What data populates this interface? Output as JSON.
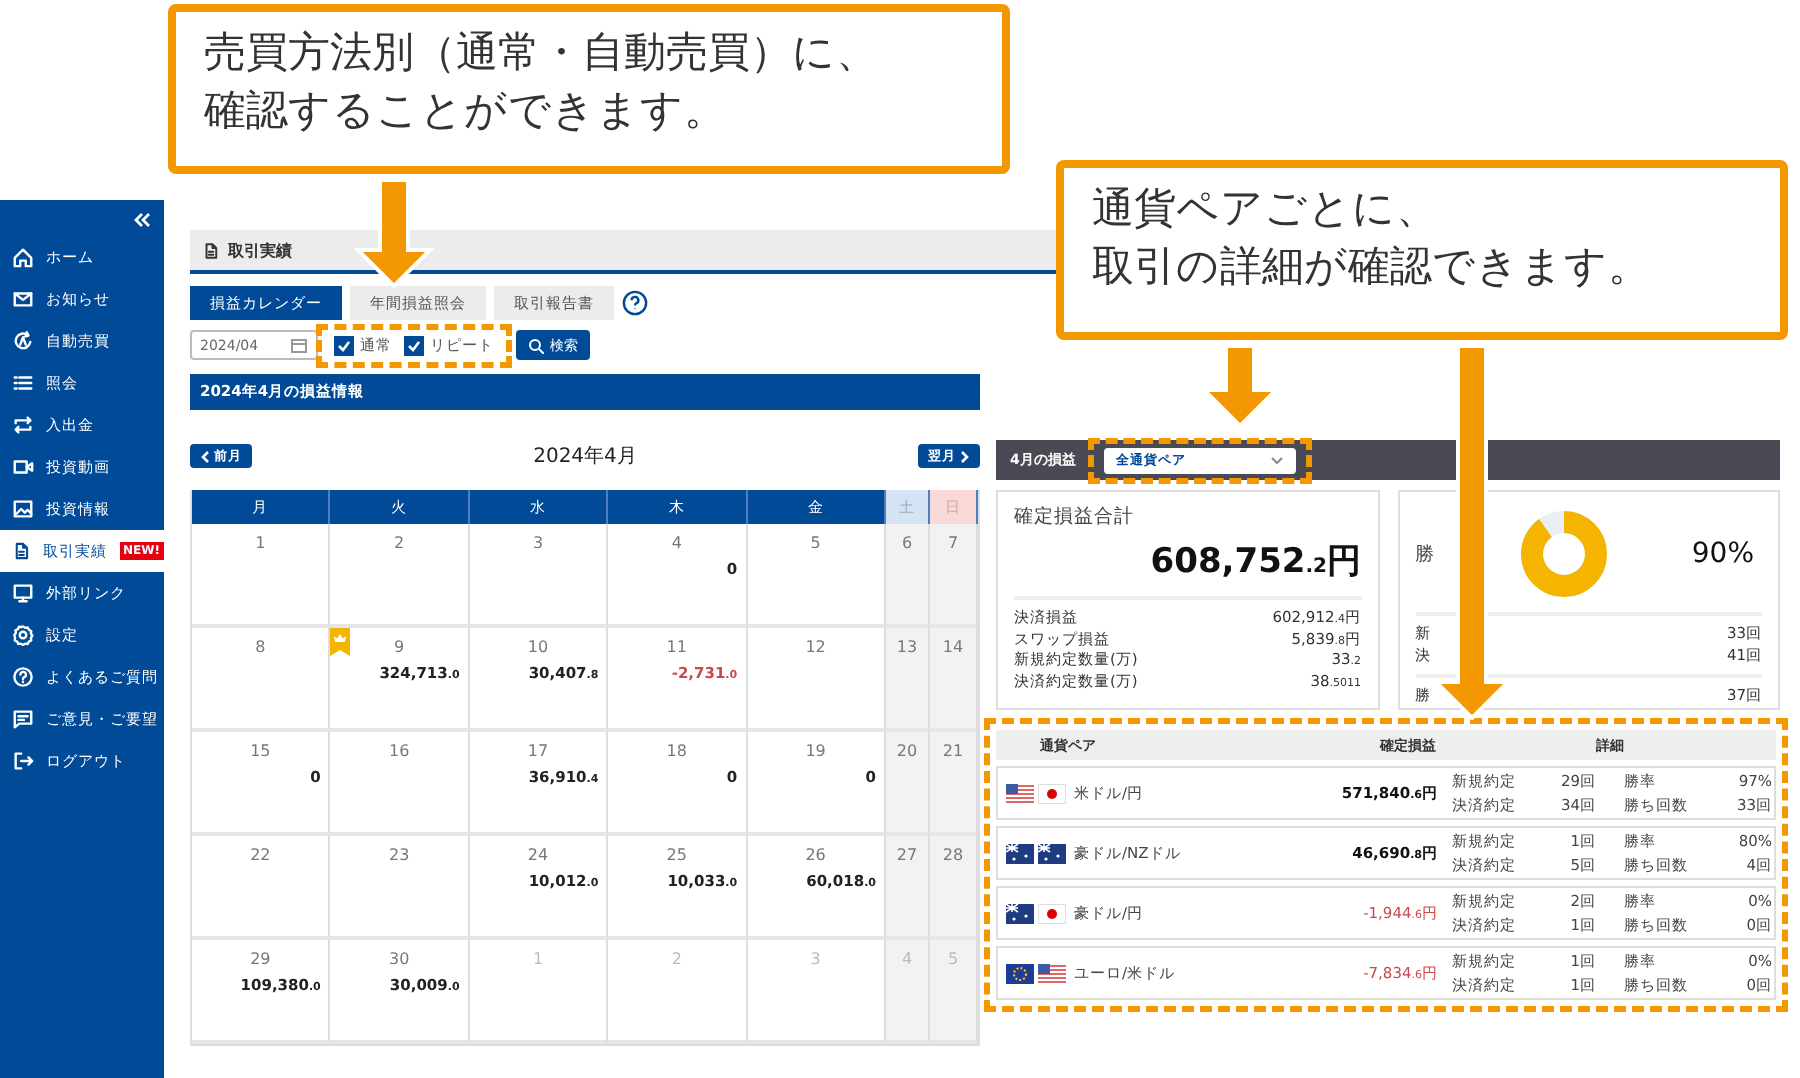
{
  "callouts": [
    {
      "lines": [
        "売買方法別（通常・自動売買）に、",
        "確認することができます。"
      ]
    },
    {
      "lines": [
        "通貨ペアごとに、",
        "取引の詳細が確認できます。"
      ]
    }
  ],
  "sidebar": {
    "items": [
      {
        "label": "ホーム",
        "selected": false
      },
      {
        "label": "お知らせ",
        "selected": false
      },
      {
        "label": "自動売買",
        "selected": false
      },
      {
        "label": "照会",
        "selected": false
      },
      {
        "label": "入出金",
        "selected": false
      },
      {
        "label": "投資動画",
        "selected": false
      },
      {
        "label": "投資情報",
        "selected": false
      },
      {
        "label": "取引実績",
        "selected": true,
        "badge": "NEW!"
      },
      {
        "label": "外部リンク",
        "selected": false
      },
      {
        "label": "設定",
        "selected": false
      },
      {
        "label": "よくあるご質問",
        "selected": false
      },
      {
        "label": "ご意見・ご要望",
        "selected": false
      },
      {
        "label": "ログアウト",
        "selected": false
      }
    ]
  },
  "page_title": "取引実績",
  "tabs": [
    {
      "label": "損益カレンダー",
      "selected": true
    },
    {
      "label": "年間損益照会",
      "selected": false
    },
    {
      "label": "取引報告書",
      "selected": false
    }
  ],
  "filter": {
    "month": "2024/04",
    "checkboxes": [
      {
        "label": "通常",
        "checked": true
      },
      {
        "label": "リピート",
        "checked": true
      }
    ],
    "search_button": "検索"
  },
  "section_header": "2024年4月の損益情報",
  "calendar": {
    "prev": "前月",
    "title": "2024年4月",
    "next": "翌月",
    "weekdays": [
      {
        "label": "月",
        "kind": "weekday"
      },
      {
        "label": "火",
        "kind": "weekday"
      },
      {
        "label": "水",
        "kind": "weekday"
      },
      {
        "label": "木",
        "kind": "weekday"
      },
      {
        "label": "金",
        "kind": "weekday"
      },
      {
        "label": "土",
        "kind": "saturday"
      },
      {
        "label": "日",
        "kind": "sunday"
      }
    ],
    "weeks": [
      [
        {
          "day": "1",
          "muted": false
        },
        {
          "day": "2",
          "muted": false
        },
        {
          "day": "3",
          "muted": false
        },
        {
          "day": "4",
          "muted": false,
          "value": "0",
          "negative": false
        },
        {
          "day": "5",
          "muted": false
        },
        {
          "day": "6",
          "muted": false
        },
        {
          "day": "7",
          "muted": false
        }
      ],
      [
        {
          "day": "8",
          "muted": false
        },
        {
          "day": "9",
          "muted": false,
          "value": "324,713.0",
          "negative": false,
          "ribbon": true
        },
        {
          "day": "10",
          "muted": false,
          "value": "30,407.8",
          "negative": false
        },
        {
          "day": "11",
          "muted": false,
          "value": "-2,731.0",
          "negative": true
        },
        {
          "day": "12",
          "muted": false
        },
        {
          "day": "13",
          "muted": false
        },
        {
          "day": "14",
          "muted": false
        }
      ],
      [
        {
          "day": "15",
          "muted": false,
          "value": "0",
          "negative": false
        },
        {
          "day": "16",
          "muted": false
        },
        {
          "day": "17",
          "muted": false,
          "value": "36,910.4",
          "negative": false
        },
        {
          "day": "18",
          "muted": false,
          "value": "0",
          "negative": false
        },
        {
          "day": "19",
          "muted": false,
          "value": "0",
          "negative": false
        },
        {
          "day": "20",
          "muted": false
        },
        {
          "day": "21",
          "muted": false
        }
      ],
      [
        {
          "day": "22",
          "muted": false
        },
        {
          "day": "23",
          "muted": false
        },
        {
          "day": "24",
          "muted": false,
          "value": "10,012.0",
          "negative": false
        },
        {
          "day": "25",
          "muted": false,
          "value": "10,033.0",
          "negative": false
        },
        {
          "day": "26",
          "muted": false,
          "value": "60,018.0",
          "negative": false
        },
        {
          "day": "27",
          "muted": false
        },
        {
          "day": "28",
          "muted": false
        }
      ],
      [
        {
          "day": "29",
          "muted": false,
          "value": "109,380.0",
          "negative": false
        },
        {
          "day": "30",
          "muted": false,
          "value": "30,009.0",
          "negative": false
        },
        {
          "day": "1",
          "muted": true
        },
        {
          "day": "2",
          "muted": true
        },
        {
          "day": "3",
          "muted": true
        },
        {
          "day": "4",
          "muted": true
        },
        {
          "day": "5",
          "muted": true
        }
      ]
    ]
  },
  "summary": {
    "title": "4月の損益",
    "pair_select": "全通貨ペア",
    "total": {
      "label": "確定損益合計",
      "amount": "608,752.2円",
      "rows": [
        {
          "label": "決済損益",
          "value": "602,912.4円"
        },
        {
          "label": "スワップ損益",
          "value": "5,839.8円"
        },
        {
          "label": "新規約定数量(万)",
          "value": "33.2"
        },
        {
          "label": "決済約定数量(万)",
          "value": "38.5011"
        }
      ]
    },
    "win": {
      "label": "勝",
      "rate": "90%",
      "level": 0.9,
      "rows_top": [
        {
          "label": "新",
          "value": "33回"
        },
        {
          "label": "決",
          "value": "41回"
        }
      ],
      "rows_bottom": [
        {
          "label": "勝",
          "value": "37回"
        }
      ]
    }
  },
  "pairs": {
    "columns": [
      "通貨ペア",
      "確定損益",
      "詳細"
    ],
    "rows": [
      {
        "name": "米ドル/円",
        "profit": "571,840.6円",
        "negative": false,
        "details": [
          {
            "label": "新規約定",
            "value": "29回"
          },
          {
            "label": "勝率",
            "value": "97%"
          },
          {
            "label": "決済約定",
            "value": "34回"
          },
          {
            "label": "勝ち回数",
            "value": "33回"
          }
        ]
      },
      {
        "name": "豪ドル/NZドル",
        "profit": "46,690.8円",
        "negative": false,
        "details": [
          {
            "label": "新規約定",
            "value": "1回"
          },
          {
            "label": "勝率",
            "value": "80%"
          },
          {
            "label": "決済約定",
            "value": "5回"
          },
          {
            "label": "勝ち回数",
            "value": "4回"
          }
        ]
      },
      {
        "name": "豪ドル/円",
        "profit": "-1,944.6円",
        "negative": true,
        "details": [
          {
            "label": "新規約定",
            "value": "2回"
          },
          {
            "label": "勝率",
            "value": "0%"
          },
          {
            "label": "決済約定",
            "value": "1回"
          },
          {
            "label": "勝ち回数",
            "value": "0回"
          }
        ]
      },
      {
        "name": "ユーロ/米ドル",
        "profit": "-7,834.6円",
        "negative": true,
        "details": [
          {
            "label": "新規約定",
            "value": "1回"
          },
          {
            "label": "勝率",
            "value": "0%"
          },
          {
            "label": "決済約定",
            "value": "1回"
          },
          {
            "label": "勝ち回数",
            "value": "0回"
          }
        ]
      }
    ]
  }
}
